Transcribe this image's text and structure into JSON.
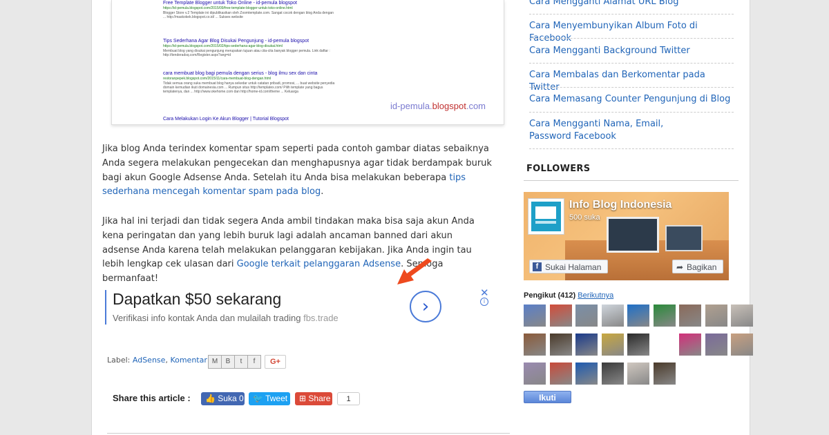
{
  "screenshot": {
    "results": [
      {
        "title": "Free Template Blogger untuk Toko Online - id-pemula blogspot",
        "url": "https://id-pemula.blogspot.com/2015/09/free-template-blogger-untuk-toko-online.html",
        "snippet": "Blogger Store v.2 Template ini dipublikasikan oleh Zoomtemplate.com. Sangat cocok dengan blog Anda dengan ... http://maskokek.blogspot.co.id/ ... Sukses website"
      },
      {
        "title": "Tips Sederhana Agar Blog Disukai Pengunjung - id-pemula blogspot",
        "url": "https://id-pemula.blogspot.com/2015/02/tips-sederhana-agar-blog-disukai.html",
        "snippet": "Membuat blog yang disukai pengunjung merupakan tujuan atau cita-cita banyak blogger pemula. Link daftar : http://tenderadsq.com/Register.aspx?ang=id"
      },
      {
        "title": "cara membuat blog bagi pemula dengan serius - blog ilmu sex dan cinta",
        "url": "restoranpepek.blogspot.com/2015/11/cara-membuat-blog-dengan.html",
        "snippet": "Tidak semua orang suka membuat blog hanya sekedar untuk catatan pribadi, promosi, ... buat website penyedia domain kemudian ikuti domainesia.com ... Rumpun situs http://templatex.com/ Pilih template yang bagus templatenya, dan ... http://www.okehome.com dan http://home-id.com/theme ... Keluarga"
      },
      {
        "title": "Cara Melakukan Login Ke Akun Blogger | Tutorial Blogspot",
        "url": "",
        "snippet": ""
      }
    ],
    "watermark_a": "id-pemula.",
    "watermark_b": "blogspot",
    "watermark_c": ".com"
  },
  "article": {
    "p1_text": "Jika blog Anda terindex komentar spam seperti pada contoh gambar diatas sebaiknya Anda segera melakukan pengecekan dan menghapusnya agar tidak berdampak buruk bagi akun Google Adsense Anda. Setelah itu Anda bisa melakukan beberapa ",
    "p1_link": "tips sederhana mencegah komentar spam pada blog",
    "p1_end": ".",
    "p2_text": "Jika hal ini terjadi dan tidak segera Anda ambil tindakan maka bisa saja akun Anda kena peringatan dan yang lebih buruk lagi adalah ancaman banned dari akun adsense Anda karena telah melakukan pelanggaran kebijakan. Jika Anda ingin tau lebih lengkap cek ulasan dari ",
    "p2_link": "Google terkait pelanggaran Adsense",
    "p2_end": ". Semoga bermanfaat!"
  },
  "ad": {
    "headline": "Dapatkan $50 sekarang",
    "subtitle": "Verifikasi info kontak Anda dan mulailah trading",
    "domain": "fbs.trade",
    "close": "✕",
    "info": "i",
    "go": "›"
  },
  "labels": {
    "prefix": "Label:",
    "items": [
      "AdSense",
      "Komentar"
    ],
    "sep": ",",
    "gplus": "G+"
  },
  "share": {
    "title": "Share this article :",
    "fb": "Suka 0",
    "tw": "Tweet",
    "gs": "Share",
    "count": "1"
  },
  "sidebar": {
    "links": [
      "Cara Mengganti Alamat URL Blog",
      "Cara Menyembunyikan Album Foto di Facebook",
      "Cara Mengganti Background Twitter",
      "Cara Membalas dan Berkomentar pada Twitter",
      "Cara Memasang Counter Pengunjung di Blog",
      "Cara Mengganti Nama, Email, Password Facebook"
    ],
    "followers_title": "FOLLOWERS",
    "fb_page": {
      "name": "Info Blog Indonesia",
      "likes": "500 suka",
      "like_btn": "Sukai Halaman",
      "share_btn": "Bagikan"
    },
    "pengikut_label": "Pengikut (412)",
    "berikutnya": "Berikutnya",
    "follow_btn": "Ikuti",
    "avatar_colors": [
      "#5a7fc8",
      "#d24c3a",
      "#7a8fa8",
      "#cfd5dc",
      "#1e6fc8",
      "#2a8a3a",
      "#8a6a5a",
      "#b0a090",
      "#c8c0b8",
      "#8a5a3a",
      "#4a3a2a",
      "#1a3a8a",
      "#c8a840",
      "#2a2a2a",
      "#ffffff",
      "#d2307a",
      "#7a6a9a",
      "#c8a080",
      "#9a8ab0",
      "#c84a3a",
      "#1e5ab0",
      "#3a3a3a",
      "#d0c8c0",
      "#4a3a2a"
    ]
  }
}
